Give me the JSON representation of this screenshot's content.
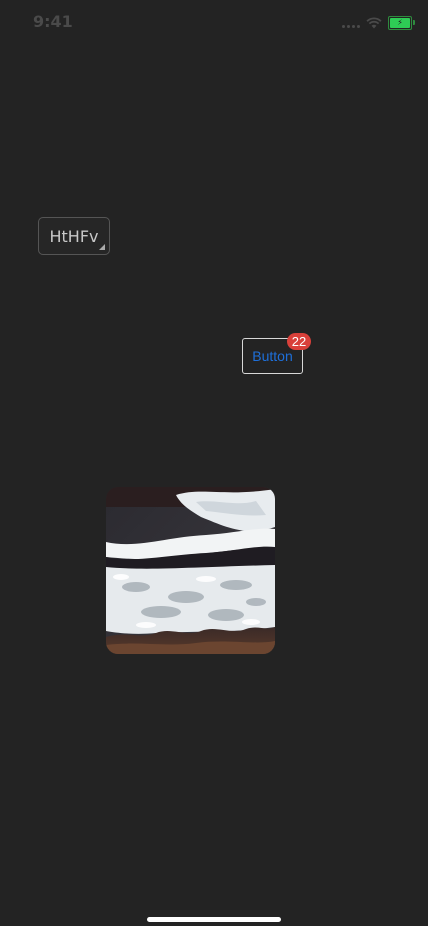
{
  "status_bar": {
    "time": "9:41",
    "signal_icon": "cellular-signal-icon",
    "wifi_icon": "wifi-icon",
    "battery_icon": "battery-charging-icon",
    "battery_color": "#2ecc55"
  },
  "picker": {
    "value": "HtHFv"
  },
  "button": {
    "label": "Button",
    "badge_count": "22",
    "label_color": "#1e6fd9",
    "badge_color": "#d9403a"
  },
  "image": {
    "subject": "ocean-waves-photo"
  }
}
